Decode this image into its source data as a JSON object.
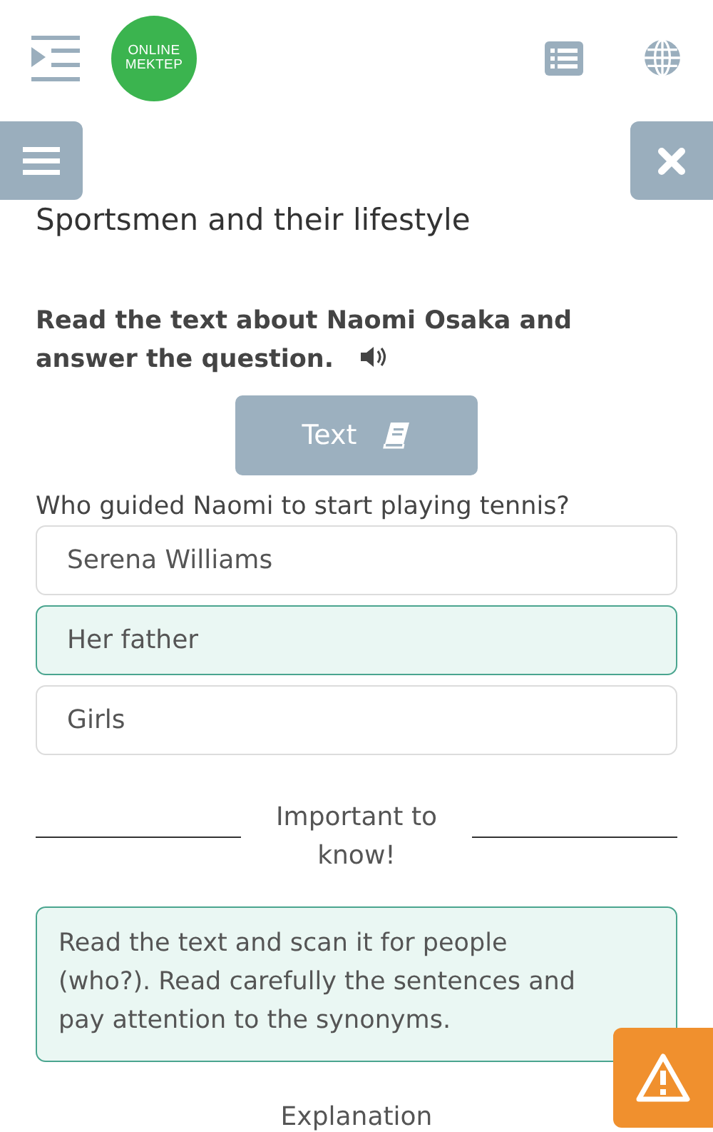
{
  "logo": {
    "line1": "ONLINE",
    "line2": "MEKTEP"
  },
  "title": "Sportsmen and their lifestyle",
  "instruction": "Read the text about Naomi Osaka and answer the question.",
  "text_button": "Text",
  "question": "Who guided Naomi to start playing tennis?",
  "options": [
    {
      "label": "Serena Williams",
      "selected": false
    },
    {
      "label": "Her father",
      "selected": true
    },
    {
      "label": "Girls",
      "selected": false
    }
  ],
  "important_heading": "Important to know!",
  "tip": "Read the text and scan it for people (who?). Read carefully the sentences and pay attention to the synonyms.",
  "explanation_heading": "Explanation"
}
